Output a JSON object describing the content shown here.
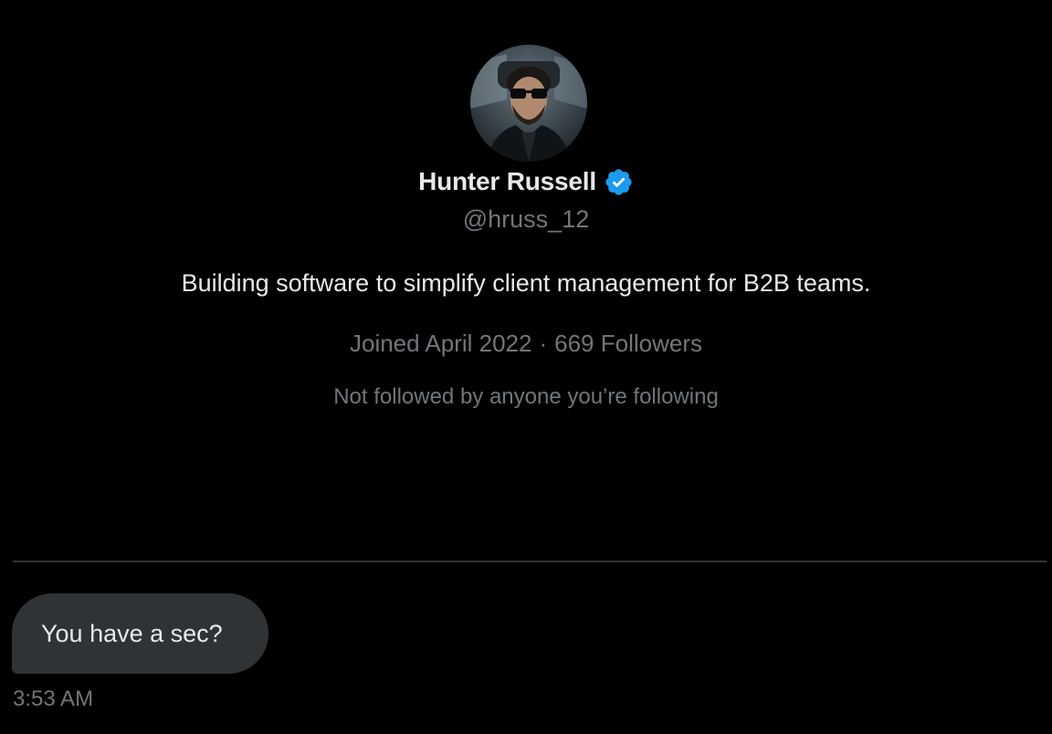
{
  "profile": {
    "name": "Hunter Russell",
    "verified": true,
    "handle": "@hruss_12",
    "bio": "Building software to simplify client management for B2B teams.",
    "joined": "Joined April 2022",
    "separator": "·",
    "followers": "669 Followers",
    "mutuals": "Not followed by anyone you’re following",
    "avatar_icon": "profile-photo",
    "verified_icon": "verified-badge-icon"
  },
  "messages": [
    {
      "text": "You have a sec?",
      "time": "3:53 AM"
    }
  ],
  "colors": {
    "background": "#000000",
    "primary_text": "#e7e9ea",
    "secondary_text": "#71767b",
    "bubble": "#2f3336",
    "divider": "#2f3336",
    "verified": "#1d9bf0"
  }
}
